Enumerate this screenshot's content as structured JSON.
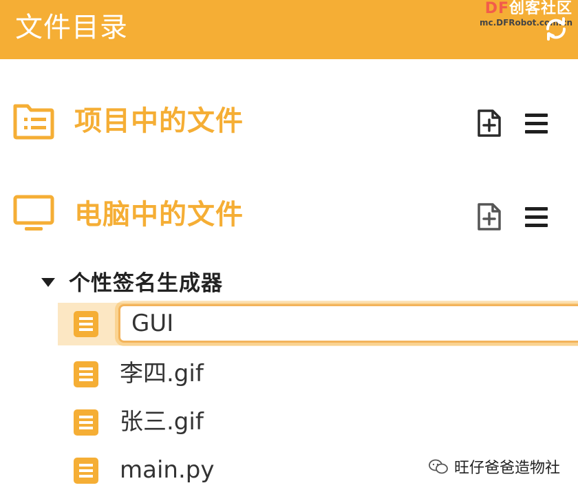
{
  "header": {
    "title": "文件目录",
    "watermark_brand_prefix": "DF",
    "watermark_brand_suffix": "创客社区",
    "watermark_url": "mc.DFRobot.com.cn",
    "refresh_icon": "refresh-icon"
  },
  "sections": {
    "project": {
      "title": "项目中的文件",
      "icon": "folder-list-icon",
      "add_icon": "file-add-icon",
      "menu_icon": "hamburger-menu-icon"
    },
    "computer": {
      "title": "电脑中的文件",
      "icon": "monitor-icon",
      "add_icon": "file-add-icon",
      "menu_icon": "hamburger-menu-icon"
    }
  },
  "tree": {
    "folder": {
      "name": "个性签名生成器",
      "expanded": true
    },
    "rename_input": {
      "value": "GUI"
    },
    "files": [
      {
        "name": "李四.gif"
      },
      {
        "name": "张三.gif"
      },
      {
        "name": "main.py"
      }
    ]
  },
  "footer_watermark": {
    "text": "旺仔爸爸造物社"
  },
  "colors": {
    "accent": "#F5AE35",
    "selected_row": "#FCE7C3",
    "icon_dark": "#2a2a2a",
    "watermark_red": "#F25C4A"
  }
}
